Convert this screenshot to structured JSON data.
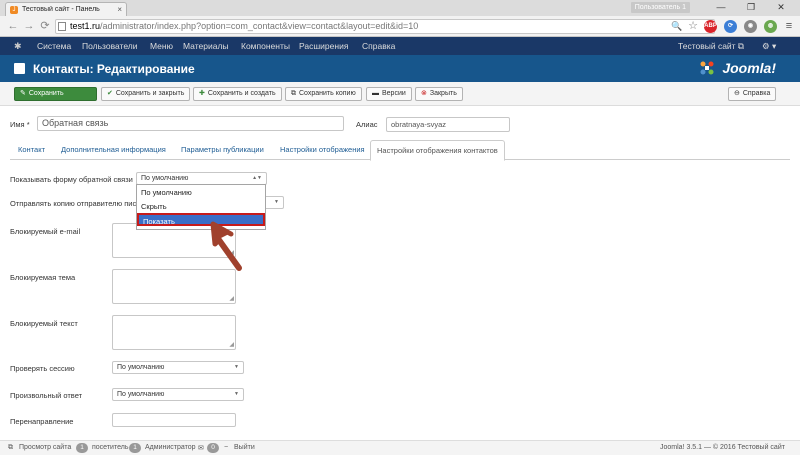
{
  "browser": {
    "tab_title": "Тестовый сайт - Панель",
    "tab_close": "×",
    "user_chip": "Пользователь 1",
    "window_controls": [
      "—",
      "❐",
      "✕"
    ],
    "url_host": "test1.ru",
    "url_path": "/administrator/index.php?option=com_contact&view=contact&layout=edit&id=10",
    "extensions": [
      {
        "name": "adblock-icon",
        "label": "ABP",
        "color": "#d9232a"
      },
      {
        "name": "sync-icon",
        "label": "⟳",
        "color": "#3b7ed6"
      },
      {
        "name": "extension-icon",
        "label": "◉",
        "color": "#888888"
      },
      {
        "name": "globe-icon",
        "label": "◍",
        "color": "#6aa84f"
      }
    ]
  },
  "topmenu": {
    "items": [
      "Система",
      "Пользователи",
      "Меню",
      "Материалы",
      "Компоненты",
      "Расширения",
      "Справка"
    ],
    "site_link": "Тестовый сайт ⧉",
    "settings_icon": "⚙ ▾"
  },
  "header": {
    "title": "Контакты: Редактирование",
    "brand": "Joomla!"
  },
  "toolbar": {
    "save": "Сохранить",
    "save_close": "Сохранить и закрыть",
    "save_new": "Сохранить и создать",
    "save_copy": "Сохранить копию",
    "versions": "Версии",
    "close": "Закрыть",
    "help": "Справка"
  },
  "form": {
    "name_label": "Имя *",
    "name_value": "Обратная связь",
    "alias_label": "Алиас",
    "alias_value": "obratnaya-svyaz"
  },
  "tabs": [
    "Контакт",
    "Дополнительная информация",
    "Параметры публикации",
    "Настройки отображения",
    "Настройки отображения контактов"
  ],
  "fields": {
    "show_form_label": "Показывать форму обратной связи",
    "show_form_value": "По умолчанию",
    "send_copy_label": "Отправлять копию отправителю письма",
    "blocked_email_label": "Блокируемый e-mail",
    "blocked_subject_label": "Блокируемая тема",
    "blocked_text_label": "Блокируемый текст",
    "check_session_label": "Проверять сессию",
    "check_session_value": "По умолчанию",
    "custom_reply_label": "Произвольный ответ",
    "custom_reply_value": "По умолчанию",
    "redirect_label": "Перенаправление"
  },
  "dropdown": {
    "options": [
      "По умолчанию",
      "Скрыть",
      "Показать"
    ],
    "selected": "Показать"
  },
  "statusbar": {
    "view_site": "Просмотр сайта",
    "visitors_count": "1",
    "visitors_label": "посетитель",
    "admins_count": "1",
    "admins_label": "Администратор",
    "messages_count": "0",
    "logout": "Выйти",
    "copyright": "Joomla! 3.5.1 — © 2016 Тестовый сайт"
  },
  "colors": {
    "menu_bg": "#1a3867",
    "header_bg": "#17568c",
    "save_green": "#3d8b3d",
    "highlight_blue": "#3a6ec7",
    "annotation_red": "#c71b1b"
  }
}
